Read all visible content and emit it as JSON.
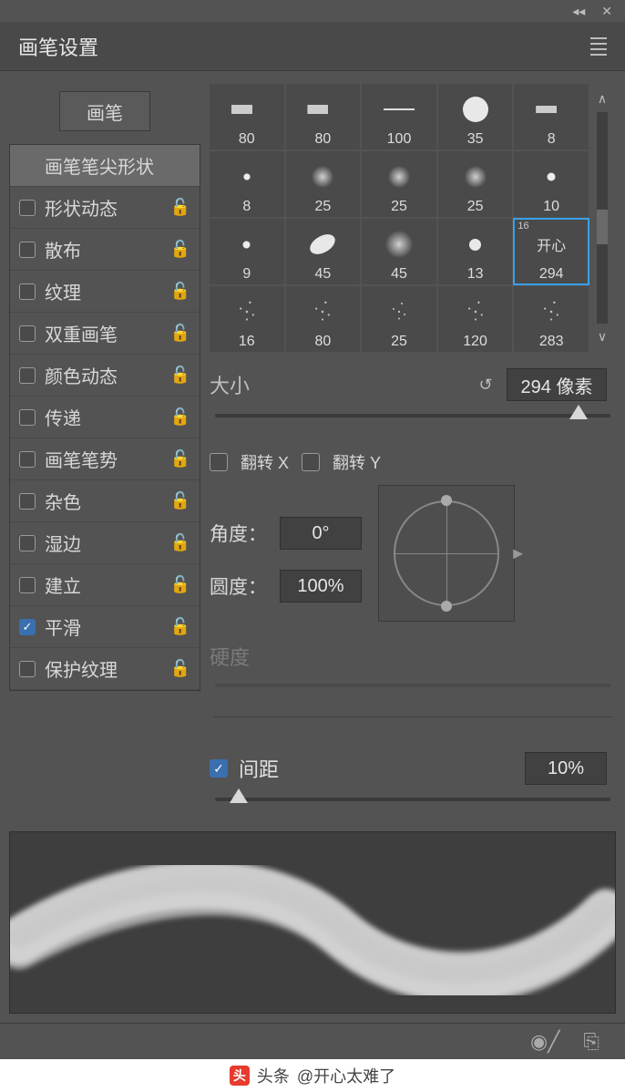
{
  "panel": {
    "title": "画笔设置",
    "tab_button": "画笔"
  },
  "options": [
    {
      "label": "画笔笔尖形状",
      "header": true
    },
    {
      "label": "形状动态",
      "checked": false,
      "locked": true
    },
    {
      "label": "散布",
      "checked": false,
      "locked": true
    },
    {
      "label": "纹理",
      "checked": false,
      "locked": true
    },
    {
      "label": "双重画笔",
      "checked": false,
      "locked": true
    },
    {
      "label": "颜色动态",
      "checked": false,
      "locked": true
    },
    {
      "label": "传递",
      "checked": false,
      "locked": true
    },
    {
      "label": "画笔笔势",
      "checked": false,
      "locked": true
    },
    {
      "label": "杂色",
      "checked": false,
      "locked": true
    },
    {
      "label": "湿边",
      "checked": false,
      "locked": true
    },
    {
      "label": "建立",
      "checked": false,
      "locked": true
    },
    {
      "label": "平滑",
      "checked": true,
      "locked": true
    },
    {
      "label": "保护纹理",
      "checked": false,
      "locked": true
    }
  ],
  "presets": [
    {
      "size": "80",
      "thumb": "pencil",
      "tw": 34,
      "th": 10
    },
    {
      "size": "80",
      "thumb": "pencil",
      "tw": 34,
      "th": 10
    },
    {
      "size": "100",
      "thumb": "line",
      "tw": 34,
      "th": 2
    },
    {
      "size": "35",
      "thumb": "hard",
      "tw": 28,
      "th": 28
    },
    {
      "size": "8",
      "thumb": "pencil",
      "tw": 34,
      "th": 8
    },
    {
      "size": "8",
      "thumb": "dot",
      "tw": 8,
      "th": 8
    },
    {
      "size": "25",
      "thumb": "soft",
      "tw": 24,
      "th": 24
    },
    {
      "size": "25",
      "thumb": "soft",
      "tw": 24,
      "th": 24
    },
    {
      "size": "25",
      "thumb": "soft",
      "tw": 24,
      "th": 24
    },
    {
      "size": "10",
      "thumb": "dot",
      "tw": 10,
      "th": 10
    },
    {
      "size": "9",
      "thumb": "dot",
      "tw": 9,
      "th": 9
    },
    {
      "size": "45",
      "thumb": "oval",
      "tw": 30,
      "th": 18
    },
    {
      "size": "45",
      "thumb": "soft",
      "tw": 30,
      "th": 30
    },
    {
      "size": "13",
      "thumb": "hard",
      "tw": 13,
      "th": 13
    },
    {
      "size": "294",
      "thumb": "text",
      "name": "开心",
      "badge": "16",
      "selected": true
    },
    {
      "size": "16",
      "thumb": "spray",
      "tw": 34,
      "th": 34
    },
    {
      "size": "80",
      "thumb": "spray",
      "tw": 34,
      "th": 34
    },
    {
      "size": "25",
      "thumb": "spray",
      "tw": 30,
      "th": 30
    },
    {
      "size": "120",
      "thumb": "spray",
      "tw": 34,
      "th": 34
    },
    {
      "size": "283",
      "thumb": "spray",
      "tw": 34,
      "th": 34
    }
  ],
  "size": {
    "label": "大小",
    "value": "294 像素",
    "slider_pct": 92
  },
  "flip": {
    "x_label": "翻转 X",
    "y_label": "翻转 Y",
    "x": false,
    "y": false
  },
  "angle": {
    "label": "角度：",
    "value": "0°"
  },
  "round": {
    "label": "圆度：",
    "value": "100%"
  },
  "hardness": {
    "label": "硬度",
    "enabled": false
  },
  "spacing": {
    "label": "间距",
    "checked": true,
    "value": "10%",
    "slider_pct": 6
  },
  "attribution": {
    "prefix": "头条",
    "user": "@开心太难了"
  }
}
